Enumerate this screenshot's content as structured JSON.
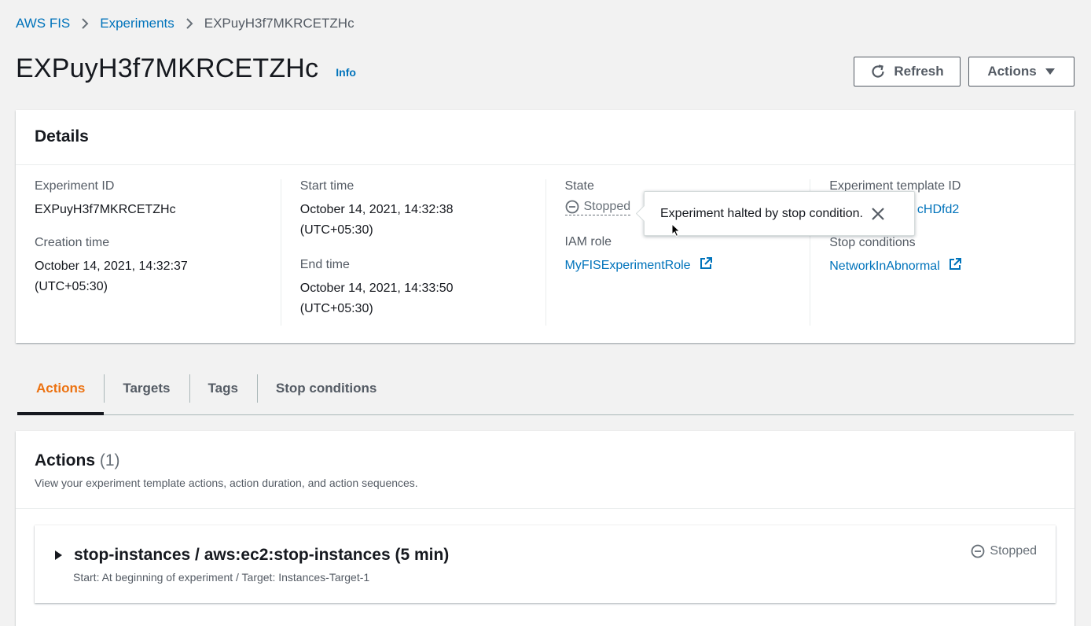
{
  "breadcrumb": {
    "items": [
      "AWS FIS",
      "Experiments"
    ],
    "current": "EXPuyH3f7MKRCETZHc"
  },
  "header": {
    "title": "EXPuyH3f7MKRCETZHc",
    "info": "Info",
    "refresh_label": "Refresh",
    "actions_label": "Actions"
  },
  "details": {
    "title": "Details",
    "experiment_id_label": "Experiment ID",
    "experiment_id": "EXPuyH3f7MKRCETZHc",
    "creation_time_label": "Creation time",
    "creation_time_line1": "October 14, 2021, 14:32:37",
    "creation_time_line2": "(UTC+05:30)",
    "start_time_label": "Start time",
    "start_time_line1": "October 14, 2021, 14:32:38",
    "start_time_line2": "(UTC+05:30)",
    "end_time_label": "End time",
    "end_time_line1": "October 14, 2021, 14:33:50",
    "end_time_line2": "(UTC+05:30)",
    "state_label": "State",
    "state": "Stopped",
    "iam_role_label": "IAM role",
    "iam_role": "MyFISExperimentRole",
    "template_id_label": "Experiment template ID",
    "template_id_visible": "cHDfd2",
    "stop_conditions_label": "Stop conditions",
    "stop_condition": "NetworkInAbnormal"
  },
  "popover": {
    "text": "Experiment halted by stop condition."
  },
  "tabs": [
    {
      "label": "Actions",
      "active": true
    },
    {
      "label": "Targets",
      "active": false
    },
    {
      "label": "Tags",
      "active": false
    },
    {
      "label": "Stop conditions",
      "active": false
    }
  ],
  "actions_panel": {
    "title": "Actions",
    "count": "(1)",
    "description": "View your experiment template actions, action duration, and action sequences.",
    "item": {
      "title": "stop-instances / aws:ec2:stop-instances (5 min)",
      "subtitle": "Start: At beginning of experiment / Target: Instances-Target-1",
      "status": "Stopped"
    }
  },
  "colors": {
    "link": "#0073bb",
    "active_tab": "#ec7211",
    "text": "#16191f",
    "muted": "#687078",
    "background": "#f2f2f2"
  },
  "icons": [
    "chevron-right-icon",
    "refresh-icon",
    "caret-down-icon",
    "stopped-icon",
    "external-link-icon",
    "close-icon",
    "mouse-cursor-icon",
    "caret-right-icon"
  ]
}
